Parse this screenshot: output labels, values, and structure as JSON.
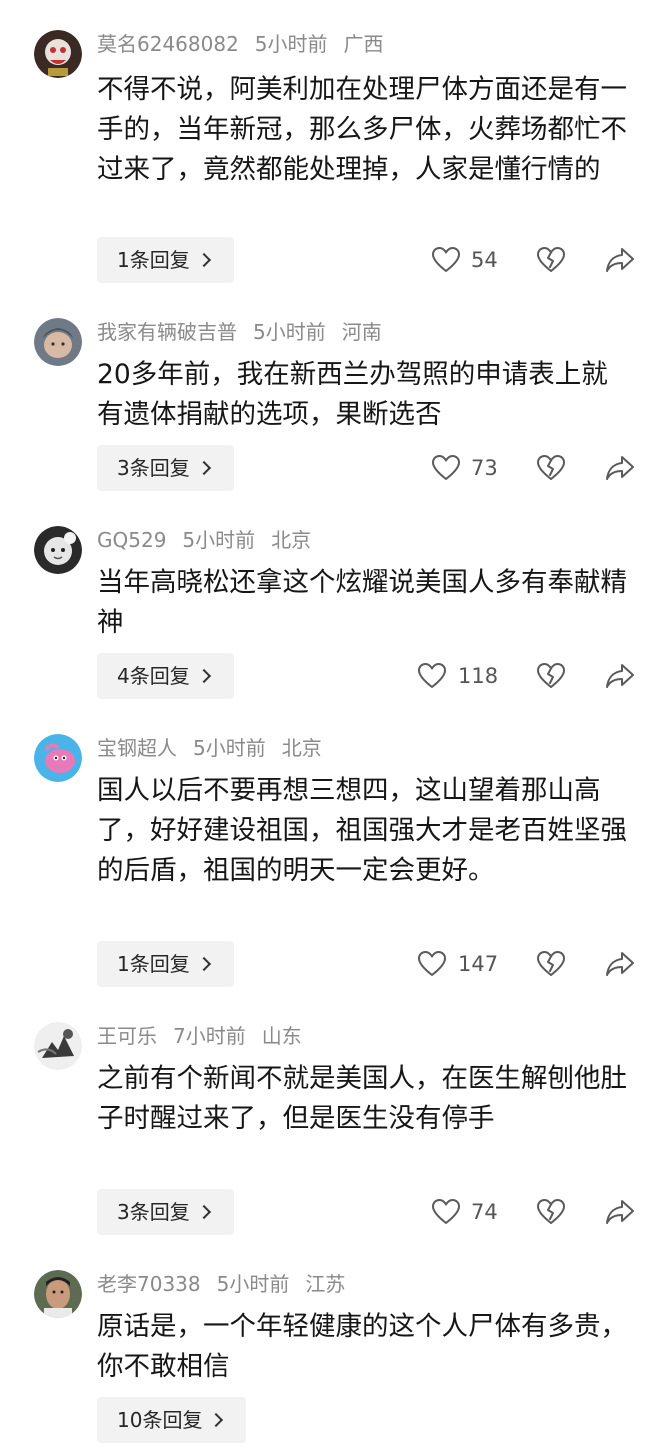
{
  "comments": [
    {
      "username": "莫名62468082",
      "time": "5小时前",
      "location": "广西",
      "text": "不得不说，阿美利加在处理尸体方面还是有一手的，当年新冠，那么多尸体，火葬场都忙不过来了，竟然都能处理掉，人家是懂行情的",
      "replies": "1条回复",
      "likes": "54"
    },
    {
      "username": "我家有辆破吉普",
      "time": "5小时前",
      "location": "河南",
      "text": "20多年前，我在新西兰办驾照的申请表上就有遗体捐献的选项，果断选否",
      "replies": "3条回复",
      "likes": "73"
    },
    {
      "username": "GQ529",
      "time": "5小时前",
      "location": "北京",
      "text": "当年高晓松还拿这个炫耀说美国人多有奉献精神",
      "replies": "4条回复",
      "likes": "118"
    },
    {
      "username": "宝钢超人",
      "time": "5小时前",
      "location": "北京",
      "text": "国人以后不要再想三想四，这山望着那山高了，好好建设祖国，祖国强大才是老百姓坚强的后盾，祖国的明天一定会更好。",
      "replies": "1条回复",
      "likes": "147"
    },
    {
      "username": "王可乐",
      "time": "7小时前",
      "location": "山东",
      "text": "之前有个新闻不就是美国人，在医生解刨他肚子时醒过来了，但是医生没有停手",
      "replies": "3条回复",
      "likes": "74"
    },
    {
      "username": "老李70338",
      "time": "5小时前",
      "location": "江苏",
      "text": "原话是，一个年轻健康的这个人尸体有多贵，你不敢相信",
      "replies": "10条回复",
      "likes": ""
    }
  ],
  "icons": {
    "like": "heart-outline",
    "dislike": "broken-heart-outline",
    "share": "share-arrow"
  }
}
